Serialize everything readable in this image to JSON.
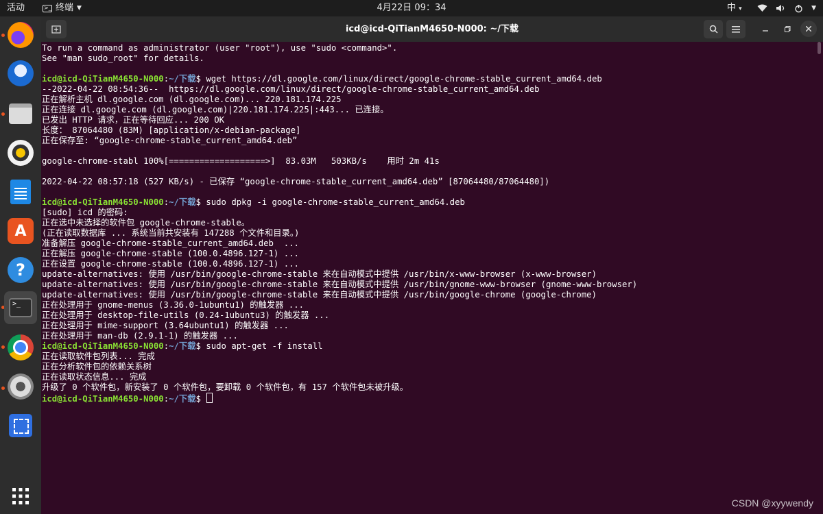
{
  "topbar": {
    "activities": "活动",
    "app_name": "终端",
    "clock": "4月22日 09：34",
    "ime": "中"
  },
  "dock": {
    "items": [
      {
        "name": "firefox",
        "icon": "firefox-icon"
      },
      {
        "name": "thunderbird",
        "icon": "thunderbird-icon"
      },
      {
        "name": "files",
        "icon": "files-icon"
      },
      {
        "name": "rhythmbox",
        "icon": "rhythmbox-icon"
      },
      {
        "name": "libreoffice-writer",
        "icon": "writer-icon"
      },
      {
        "name": "software",
        "icon": "software-icon"
      },
      {
        "name": "help",
        "icon": "help-icon"
      },
      {
        "name": "terminal",
        "icon": "terminal-icon"
      },
      {
        "name": "chrome",
        "icon": "chrome-icon"
      },
      {
        "name": "settings",
        "icon": "settings-icon"
      },
      {
        "name": "screenshot",
        "icon": "screenshot-icon"
      },
      {
        "name": "show-apps",
        "icon": "apps-grid-icon"
      }
    ]
  },
  "window": {
    "title": "icd@icd-QiTianM4650-N000: ~/下载"
  },
  "prompt": {
    "user": "icd@icd-QiTianM4650-N000",
    "path": "~/下载"
  },
  "terminal": {
    "lines": [
      {
        "type": "text",
        "text": "To run a command as administrator (user \"root\"), use \"sudo <command>\"."
      },
      {
        "type": "text",
        "text": "See \"man sudo_root\" for details."
      },
      {
        "type": "text",
        "text": ""
      },
      {
        "type": "prompt",
        "cmd": "wget https://dl.google.com/linux/direct/google-chrome-stable_current_amd64.deb"
      },
      {
        "type": "text",
        "text": "--2022-04-22 08:54:36--  https://dl.google.com/linux/direct/google-chrome-stable_current_amd64.deb"
      },
      {
        "type": "text",
        "text": "正在解析主机 dl.google.com (dl.google.com)... 220.181.174.225"
      },
      {
        "type": "text",
        "text": "正在连接 dl.google.com (dl.google.com)|220.181.174.225|:443... 已连接。"
      },
      {
        "type": "text",
        "text": "已发出 HTTP 请求，正在等待回应... 200 OK"
      },
      {
        "type": "text",
        "text": "长度： 87064480 (83M) [application/x-debian-package]"
      },
      {
        "type": "text",
        "text": "正在保存至: “google-chrome-stable_current_amd64.deb”"
      },
      {
        "type": "text",
        "text": ""
      },
      {
        "type": "text",
        "text": "google-chrome-stabl 100%[===================>]  83.03M   503KB/s    用时 2m 41s"
      },
      {
        "type": "text",
        "text": ""
      },
      {
        "type": "text",
        "text": "2022-04-22 08:57:18 (527 KB/s) - 已保存 “google-chrome-stable_current_amd64.deb” [87064480/87064480])"
      },
      {
        "type": "text",
        "text": ""
      },
      {
        "type": "prompt",
        "cmd": "sudo dpkg -i google-chrome-stable_current_amd64.deb"
      },
      {
        "type": "text",
        "text": "[sudo] icd 的密码:"
      },
      {
        "type": "text",
        "text": "正在选中未选择的软件包 google-chrome-stable。"
      },
      {
        "type": "text",
        "text": "(正在读取数据库 ... 系统当前共安装有 147288 个文件和目录。)"
      },
      {
        "type": "text",
        "text": "准备解压 google-chrome-stable_current_amd64.deb  ..."
      },
      {
        "type": "text",
        "text": "正在解压 google-chrome-stable (100.0.4896.127-1) ..."
      },
      {
        "type": "text",
        "text": "正在设置 google-chrome-stable (100.0.4896.127-1) ..."
      },
      {
        "type": "text",
        "text": "update-alternatives: 使用 /usr/bin/google-chrome-stable 来在自动模式中提供 /usr/bin/x-www-browser (x-www-browser)"
      },
      {
        "type": "text",
        "text": "update-alternatives: 使用 /usr/bin/google-chrome-stable 来在自动模式中提供 /usr/bin/gnome-www-browser (gnome-www-browser)"
      },
      {
        "type": "text",
        "text": "update-alternatives: 使用 /usr/bin/google-chrome-stable 来在自动模式中提供 /usr/bin/google-chrome (google-chrome)"
      },
      {
        "type": "text",
        "text": "正在处理用于 gnome-menus (3.36.0-1ubuntu1) 的触发器 ..."
      },
      {
        "type": "text",
        "text": "正在处理用于 desktop-file-utils (0.24-1ubuntu3) 的触发器 ..."
      },
      {
        "type": "text",
        "text": "正在处理用于 mime-support (3.64ubuntu1) 的触发器 ..."
      },
      {
        "type": "text",
        "text": "正在处理用于 man-db (2.9.1-1) 的触发器 ..."
      },
      {
        "type": "prompt",
        "cmd": "sudo apt-get -f install"
      },
      {
        "type": "text",
        "text": "正在读取软件包列表... 完成"
      },
      {
        "type": "text",
        "text": "正在分析软件包的依赖关系树"
      },
      {
        "type": "text",
        "text": "正在读取状态信息... 完成"
      },
      {
        "type": "text",
        "text": "升级了 0 个软件包，新安装了 0 个软件包，要卸载 0 个软件包，有 157 个软件包未被升级。"
      },
      {
        "type": "prompt",
        "cmd": "",
        "cursor": true
      }
    ]
  },
  "watermark": "CSDN @xyywendy",
  "colors": {
    "terminal_bg": "#300a24",
    "prompt_user": "#8ae234",
    "prompt_path": "#729fcf",
    "ubuntu_orange": "#e95420"
  }
}
